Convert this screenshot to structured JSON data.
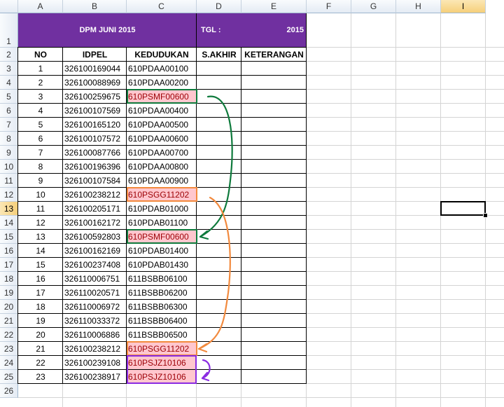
{
  "columns": [
    "A",
    "B",
    "C",
    "D",
    "E",
    "F",
    "G",
    "H",
    "I"
  ],
  "selected_column": "I",
  "rows": [
    "1",
    "2",
    "3",
    "4",
    "5",
    "6",
    "7",
    "8",
    "9",
    "10",
    "11",
    "12",
    "13",
    "14",
    "15",
    "16",
    "17",
    "18",
    "19",
    "20",
    "21",
    "22",
    "23",
    "24",
    "25",
    "26"
  ],
  "selected_row": "13",
  "title": {
    "left": "DPM JUNI 2015",
    "tgl_label": "TGL :",
    "tgl_value": "2015",
    "fill_color": "#7030a0"
  },
  "headers": [
    "NO",
    "IDPEL",
    "KEDUDUKAN",
    "S.AKHIR",
    "KETERANGAN"
  ],
  "records": [
    {
      "no": "1",
      "idpel": "326100169044",
      "kedudukan": "610PDAA00100"
    },
    {
      "no": "2",
      "idpel": "326100088969",
      "kedudukan": "610PDAA00200"
    },
    {
      "no": "3",
      "idpel": "326100259675",
      "kedudukan": "610PSMF00600"
    },
    {
      "no": "4",
      "idpel": "326100107569",
      "kedudukan": "610PDAA00400"
    },
    {
      "no": "5",
      "idpel": "326100165120",
      "kedudukan": "610PDAA00500"
    },
    {
      "no": "6",
      "idpel": "326100107572",
      "kedudukan": "610PDAA00600"
    },
    {
      "no": "7",
      "idpel": "326100087766",
      "kedudukan": "610PDAA00700"
    },
    {
      "no": "8",
      "idpel": "326100196396",
      "kedudukan": "610PDAA00800"
    },
    {
      "no": "9",
      "idpel": "326100107584",
      "kedudukan": "610PDAA00900"
    },
    {
      "no": "10",
      "idpel": "326100238212",
      "kedudukan": "610PSGG11202"
    },
    {
      "no": "11",
      "idpel": "326100205171",
      "kedudukan": "610PDAB01000"
    },
    {
      "no": "12",
      "idpel": "326100162172",
      "kedudukan": "610PDAB01100"
    },
    {
      "no": "13",
      "idpel": "326100592803",
      "kedudukan": "610PSMF00600"
    },
    {
      "no": "14",
      "idpel": "326100162169",
      "kedudukan": "610PDAB01400"
    },
    {
      "no": "15",
      "idpel": "326100237408",
      "kedudukan": "610PDAB01430"
    },
    {
      "no": "16",
      "idpel": "326110006751",
      "kedudukan": "611BSBB06100"
    },
    {
      "no": "17",
      "idpel": "326110020571",
      "kedudukan": "611BSBB06200"
    },
    {
      "no": "18",
      "idpel": "326110006972",
      "kedudukan": "611BSBB06300"
    },
    {
      "no": "19",
      "idpel": "326110033372",
      "kedudukan": "611BSBB06400"
    },
    {
      "no": "20",
      "idpel": "326110006886",
      "kedudukan": "611BSBB06500"
    },
    {
      "no": "21",
      "idpel": "326100238212",
      "kedudukan": "610PSGG11202"
    },
    {
      "no": "22",
      "idpel": "326100239108",
      "kedudukan": "610PSJZ10106"
    },
    {
      "no": "23",
      "idpel": "326100238917",
      "kedudukan": "610PSJZ10106"
    }
  ],
  "duplicate_highlight": {
    "fill": "#ffc7ce",
    "text": "#9c0006"
  },
  "duplicate_groups": [
    {
      "name": "psmf",
      "color": "#0e7a3c",
      "items": [
        3,
        13
      ]
    },
    {
      "name": "psgg",
      "color": "#f28a3e",
      "items": [
        10,
        21
      ]
    },
    {
      "name": "psjz",
      "color": "#8a2be2",
      "items": [
        22,
        23
      ]
    }
  ],
  "active_cell": "I13"
}
